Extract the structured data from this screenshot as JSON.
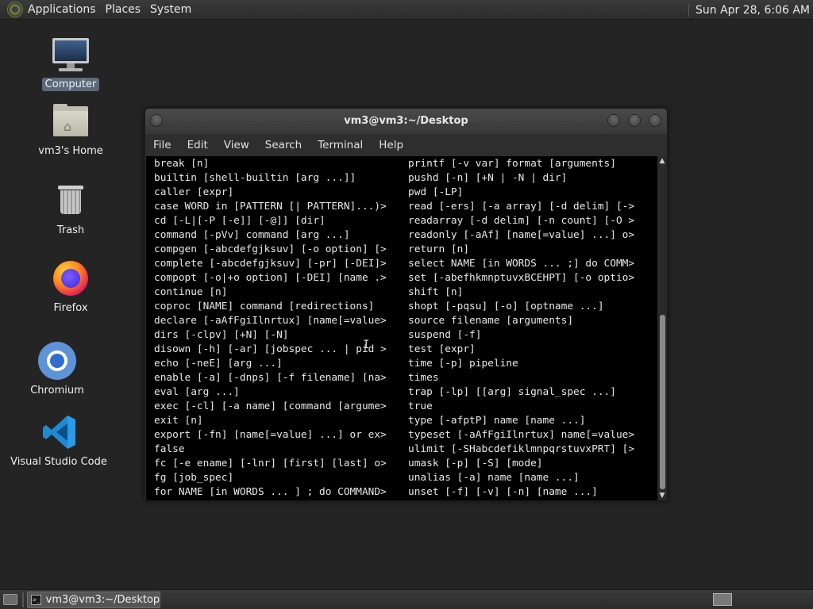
{
  "top_panel": {
    "menus": [
      "Applications",
      "Places",
      "System"
    ],
    "clock": "Sun Apr 28,  6:06 AM"
  },
  "desktop_icons": [
    {
      "label": "Computer",
      "icon": "computer-icon"
    },
    {
      "label": "vm3's Home",
      "icon": "home-folder-icon"
    },
    {
      "label": "Trash",
      "icon": "trash-icon"
    },
    {
      "label": "Firefox",
      "icon": "firefox-icon"
    },
    {
      "label": "Chromium",
      "icon": "chromium-icon"
    },
    {
      "label": "Visual Studio Code",
      "icon": "vscode-icon"
    }
  ],
  "terminal": {
    "title": "vm3@vm3:~/Desktop",
    "menu": [
      "File",
      "Edit",
      "View",
      "Search",
      "Terminal",
      "Help"
    ],
    "left_column": [
      "break [n]",
      "builtin [shell-builtin [arg ...]]",
      "caller [expr]",
      "case WORD in [PATTERN [| PATTERN]...)>",
      "cd [-L|[-P [-e]] [-@]] [dir]",
      "command [-pVv] command [arg ...]",
      "compgen [-abcdefgjksuv] [-o option] [>",
      "complete [-abcdefgjksuv] [-pr] [-DEI]>",
      "compopt [-o|+o option] [-DEI] [name .>",
      "continue [n]",
      "coproc [NAME] command [redirections]",
      "declare [-aAfFgiIlnrtux] [name[=value>",
      "dirs [-clpv] [+N] [-N]",
      "disown [-h] [-ar] [jobspec ... | pid >",
      "echo [-neE] [arg ...]",
      "enable [-a] [-dnps] [-f filename] [na>",
      "eval [arg ...]",
      "exec [-cl] [-a name] [command [argume>",
      "exit [n]",
      "export [-fn] [name[=value] ...] or ex>",
      "false",
      "fc [-e ename] [-lnr] [first] [last] o>",
      "fg [job_spec]",
      "for NAME [in WORDS ... ] ; do COMMAND>"
    ],
    "right_column": [
      "printf [-v var] format [arguments]",
      "pushd [-n] [+N | -N | dir]",
      "pwd [-LP]",
      "read [-ers] [-a array] [-d delim] [->",
      "readarray [-d delim] [-n count] [-O >",
      "readonly [-aAf] [name[=value] ...] o>",
      "return [n]",
      "select NAME [in WORDS ... ;] do COMM>",
      "set [-abefhkmnptuvxBCEHPT] [-o optio>",
      "shift [n]",
      "shopt [-pqsu] [-o] [optname ...]",
      "source filename [arguments]",
      "suspend [-f]",
      "test [expr]",
      "time [-p] pipeline",
      "times",
      "trap [-lp] [[arg] signal_spec ...]",
      "true",
      "type [-afptP] name [name ...]",
      "typeset [-aAfFgiIlnrtux] name[=value>",
      "ulimit [-SHabcdefiklmnpqrstuvxPRT] [>",
      "umask [-p] [-S] [mode]",
      "unalias [-a] name [name ...]",
      "unset [-f] [-v] [-n] [name ...]"
    ]
  },
  "taskbar": {
    "task_label": "vm3@vm3:~/Desktop"
  }
}
